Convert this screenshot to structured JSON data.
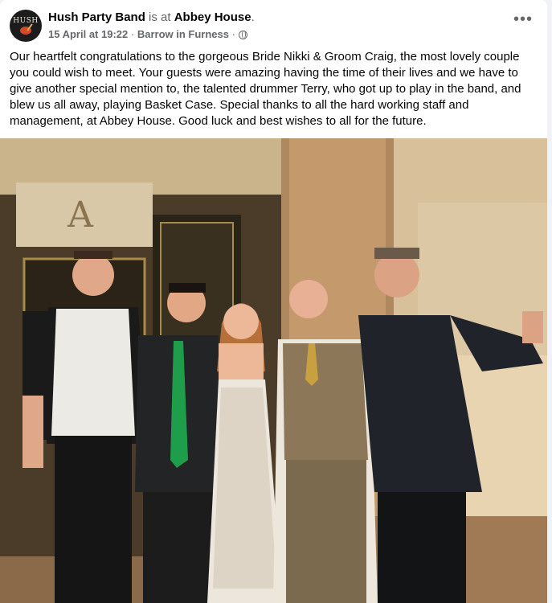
{
  "post": {
    "page_name": "Hush Party Band",
    "is_at_label": "is at",
    "place": "Abbey House",
    "period": ".",
    "date": "15 April at 19:22",
    "separator": "·",
    "location": "Barrow in Furness",
    "privacy_icon": "globe-icon",
    "more_icon": "more-options-icon",
    "more_label": "•••",
    "avatar_text": "HUSH",
    "text": "Our heartfelt congratulations to the gorgeous Bride Nikki &  Groom Craig, the most lovely couple you could wish to meet. Your guests were amazing having the time of their lives and we have to give another special mention to, the talented drummer Terry, who got up to play in the band, and blew us all away, playing Basket Case. Special thanks to all the hard working staff and management, at Abbey House. Good luck and best wishes to all for the future."
  },
  "colors": {
    "text_primary": "#050505",
    "text_secondary": "#65676b",
    "background": "#f0f2f5",
    "card": "#ffffff"
  }
}
